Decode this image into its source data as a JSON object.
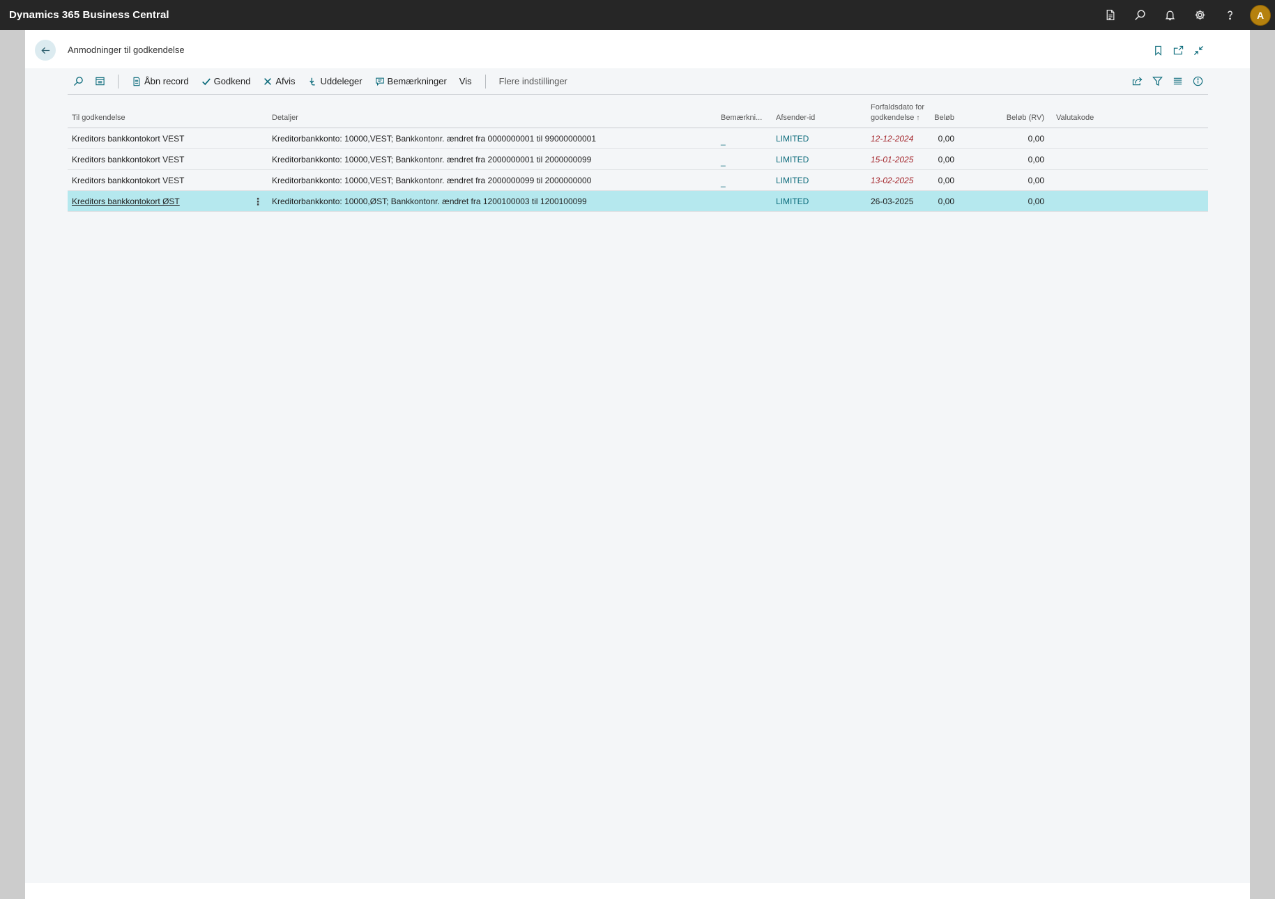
{
  "app": {
    "title": "Dynamics 365 Business Central",
    "icons": [
      "report-icon",
      "search-icon",
      "bell-icon",
      "gear-icon",
      "help-icon"
    ],
    "avatar_initial": "A"
  },
  "page": {
    "title": "Anmodninger til godkendelse"
  },
  "actions": {
    "open_record": "Åbn record",
    "approve": "Godkend",
    "reject": "Afvis",
    "delegate": "Uddeleger",
    "comments": "Bemærkninger",
    "show": "Vis",
    "more_options": "Flere indstillinger"
  },
  "table": {
    "headers": {
      "to_approve": "Til godkendelse",
      "details": "Detaljer",
      "comments": "Bemærkni...",
      "sender_id": "Afsender-id",
      "due_date_line1": "Forfaldsdato for",
      "due_date_line2": "godkendelse",
      "amount": "Beløb",
      "amount_lcy": "Beløb (RV)",
      "currency": "Valutakode"
    },
    "rows": [
      {
        "to_approve": "Kreditors bankkontokort VEST",
        "details": "Kreditorbankkonto: 10000,VEST; Bankkontonr. ændret fra 0000000001 til 99000000001",
        "comments": "_",
        "sender_id": "LIMITED",
        "due_date": "12-12-2024",
        "amount": "0,00",
        "amount_lcy": "0,00",
        "currency": ""
      },
      {
        "to_approve": "Kreditors bankkontokort VEST",
        "details": "Kreditorbankkonto: 10000,VEST; Bankkontonr. ændret fra 2000000001 til 2000000099",
        "comments": "_",
        "sender_id": "LIMITED",
        "due_date": "15-01-2025",
        "amount": "0,00",
        "amount_lcy": "0,00",
        "currency": ""
      },
      {
        "to_approve": "Kreditors bankkontokort VEST",
        "details": "Kreditorbankkonto: 10000,VEST; Bankkontonr. ændret fra 2000000099 til 2000000000",
        "comments": "_",
        "sender_id": "LIMITED",
        "due_date": "13-02-2025",
        "amount": "0,00",
        "amount_lcy": "0,00",
        "currency": ""
      },
      {
        "to_approve": "Kreditors bankkontokort ØST",
        "details": "Kreditorbankkonto: 10000,ØST; Bankkontonr. ændret fra 1200100003 til 1200100099",
        "comments": "",
        "sender_id": "LIMITED",
        "due_date": "26-03-2025",
        "amount": "0,00",
        "amount_lcy": "0,00",
        "currency": ""
      }
    ]
  },
  "colors": {
    "appbar": "#262626",
    "accent": "#0a6a7a",
    "overdue": "#a4262c",
    "selected_row": "#b5e8ee",
    "avatar": "#b5810e"
  }
}
